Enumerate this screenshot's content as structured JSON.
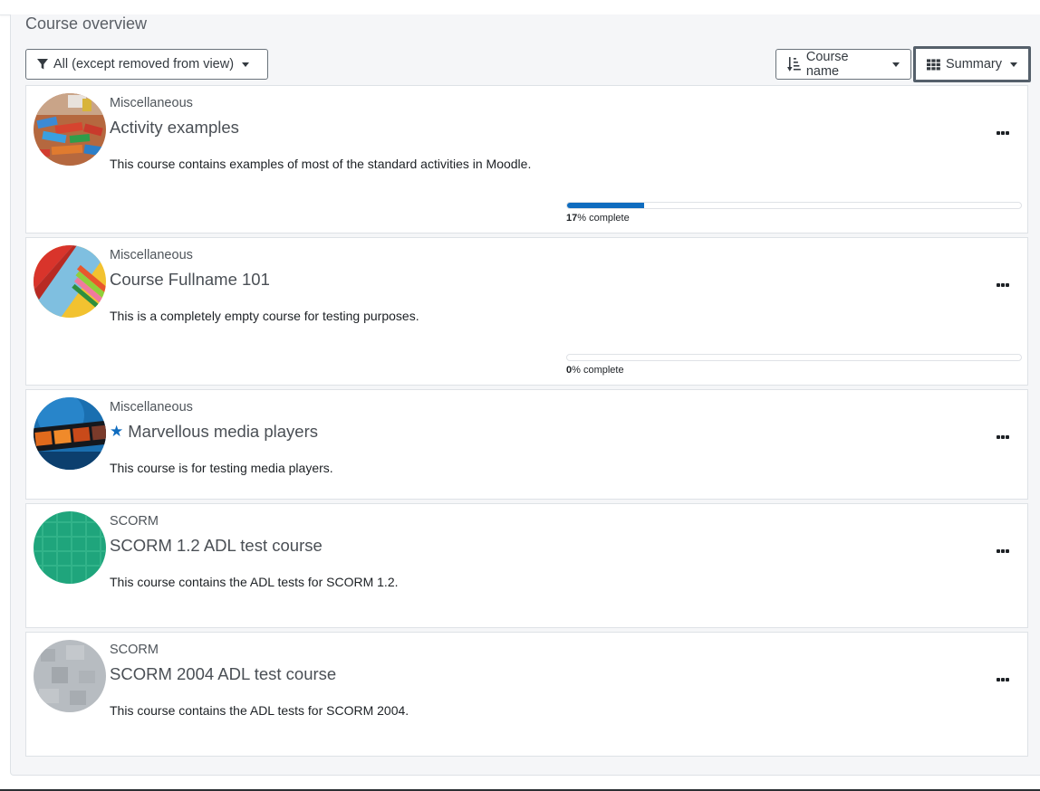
{
  "block": {
    "title": "Course overview"
  },
  "controls": {
    "filter_label": "All (except removed from view)",
    "sort_label": "Course name",
    "view_label": "Summary"
  },
  "courses": [
    {
      "category": "Miscellaneous",
      "name": "Activity examples",
      "starred": false,
      "summary": "This course contains examples of most of the standard activities in Moodle.",
      "progress": {
        "percent": 17,
        "value_text": "17",
        "suffix_text": "% complete"
      },
      "image_icon": "toy-blocks-image"
    },
    {
      "category": "Miscellaneous",
      "name": "Course Fullname 101",
      "starred": false,
      "summary": "This is a completely empty course for testing purposes.",
      "progress": {
        "percent": 0,
        "value_text": "0",
        "suffix_text": "% complete"
      },
      "image_icon": "colored-pencils-image"
    },
    {
      "category": "Miscellaneous",
      "name": "Marvellous media players",
      "starred": true,
      "summary": "This course is for testing media players.",
      "image_icon": "film-strip-image"
    },
    {
      "category": "SCORM",
      "name": "SCORM 1.2 ADL test course",
      "starred": false,
      "summary": "This course contains the ADL tests for SCORM 1.2.",
      "image_icon": "green-pattern-image"
    },
    {
      "category": "SCORM",
      "name": "SCORM 2004 ADL test course",
      "starred": false,
      "summary": "This course contains the ADL tests for SCORM 2004.",
      "image_icon": "grey-pattern-image"
    }
  ],
  "colors": {
    "accent": "#0f6cbf",
    "panel_bg": "#f5f6f8",
    "border": "#dee2e6"
  }
}
